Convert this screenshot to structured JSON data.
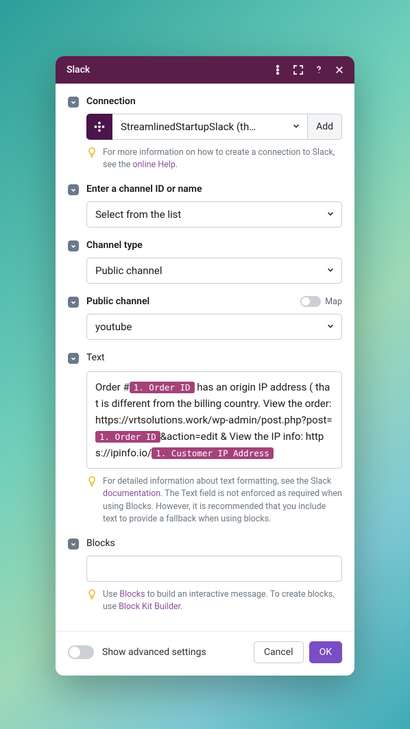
{
  "header": {
    "title": "Slack"
  },
  "connection": {
    "label": "Connection",
    "selected": "StreamlinedStartupSlack (th…",
    "add_label": "Add",
    "hint_prefix": "For more information on how to create a connection to Slack, see the ",
    "hint_link": "online Help",
    "hint_suffix": "."
  },
  "channel_id": {
    "label": "Enter a channel ID or name",
    "selected": "Select from the list"
  },
  "channel_type": {
    "label": "Channel type",
    "selected": "Public channel"
  },
  "public_channel": {
    "label": "Public channel",
    "map_label": "Map",
    "selected": "youtube"
  },
  "text": {
    "label": "Text",
    "part1": "Order #",
    "tag1": "1. Order ID",
    "part2": " has an origin IP address ( that is different from the billing country. View the order: https://vrtsolutions.work/wp-admin/post.php?post=",
    "tag2": "1. Order ID",
    "part3": "&action=edit & View the IP info: https://ipinfo.io/",
    "tag3": "1. Customer IP Address",
    "hint_prefix": "For detailed information about text formatting, see the Slack ",
    "hint_link1": "documentation",
    "hint_mid": ". The Text field is not enforced as required when using Blocks. However, it is recommended that you include text to provide a fallback when using blocks."
  },
  "blocks": {
    "label": "Blocks",
    "hint_prefix": "Use ",
    "hint_link1": "Blocks",
    "hint_mid": " to build an interactive message. To create blocks, use ",
    "hint_link2": "Block Kit Builder",
    "hint_suffix": "."
  },
  "footer": {
    "advanced_label": "Show advanced settings",
    "cancel": "Cancel",
    "ok": "OK"
  }
}
